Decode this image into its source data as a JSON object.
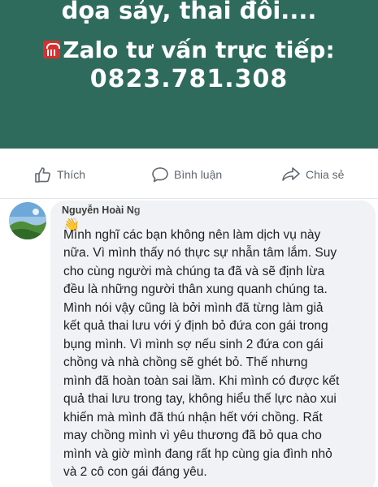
{
  "banner": {
    "line1": "dọa sảy, thai đôi....",
    "line2": "Zalo tư vấn trực tiếp:",
    "line3": "0823.781.308",
    "phone_icon": "telephone-icon"
  },
  "actions": {
    "like_label": "Thích",
    "comment_label": "Bình luận",
    "share_label": "Chia sẻ"
  },
  "comment": {
    "author": "Nguyễn Hoài Ng",
    "emoji": "👋",
    "lines": [
      "Mình nghĩ các bạn không nên làm dịch vụ này",
      "nữa. Vì mình thấy nó thực sự nhẫn tâm lắm. Suy",
      "cho cùng người mà chúng ta đã và sẽ định lừa",
      "đều là những người thân xung quanh chúng ta.",
      "Mình nói vậy cũng là bởi mình đã từng làm giả",
      "kết quả thai lưu với ý định bỏ đứa con gái trong",
      "bụng mình. Vì mình sợ nếu sinh 2 đứa con gái",
      "chồng và nhà chồng sẽ ghét bỏ. Thế nhưng",
      "mình đã hoàn toàn sai lầm. Khi mình có được kết",
      "quả thai lưu trong tay, không hiểu thế lực nào xui",
      "khiến mà mình đã thú nhận hết với chồng. Rất",
      "may chồng mình vì yêu thương đã bỏ qua cho",
      "mình và giờ mình đang rất hp cùng gia đình nhỏ",
      "và 2 cô con gái đáng yêu."
    ]
  },
  "colors": {
    "banner_bg": "#2f6b5c",
    "bubble_bg": "#f0f2f5",
    "action_text": "#606770"
  }
}
